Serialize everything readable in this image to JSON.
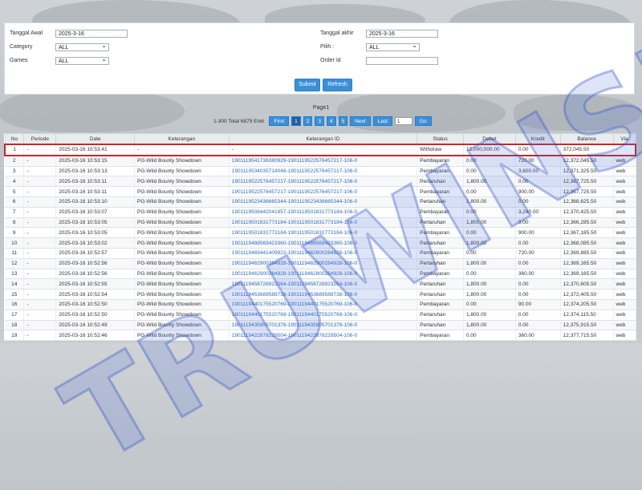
{
  "filter": {
    "tanggal_awal_label": "Tanggal Awal",
    "tanggal_awal_value": "2025-3-16",
    "tanggal_akhir_label": "Tanggal akhir",
    "tanggal_akhir_value": "2025-3-16",
    "category_label": "Category",
    "category_value": "ALL",
    "pilih_label": "Pilih :",
    "pilih_value": "ALL",
    "games_label": "Games",
    "games_value": "ALL",
    "order_label": "Order Id",
    "order_value": "",
    "submit_label": "Submit",
    "refresh_label": "Refresh"
  },
  "pager": {
    "page_title": "Page1",
    "total_text": "1-300 Total 6879 Entri",
    "first": "First",
    "pages": [
      "1",
      "2",
      "3",
      "4",
      "5"
    ],
    "next": "Next",
    "last": "Last",
    "input_value": "1",
    "go": "Go"
  },
  "watermark": "TRUWINSLOT",
  "table": {
    "headers": [
      "No",
      "Periode",
      "Date",
      "Keterangan",
      "Keterangan ID",
      "Status",
      "Debet",
      "Kredit",
      "Balance",
      "Via"
    ],
    "rows": [
      [
        "1",
        "-",
        "2025-03-16 10:53:41",
        "-",
        "-",
        "Withdraw",
        "12,000,000.00",
        "0.00",
        "372,045.50",
        "-"
      ],
      [
        "2",
        "-",
        "2025-03-16 10:53:15",
        "PG-Wild Bounty Showdown",
        "1901119541736380929-1901119522576457217-106-0",
        "Pembayaran",
        "0.00",
        "720.00",
        "12,372,045.50",
        "web"
      ],
      [
        "3",
        "-",
        "2025-03-16 10:53:13",
        "PG-Wild Bounty Showdown",
        "1901119534035714048-1901119522576457217-106-0",
        "Pembayaran",
        "0.00",
        "3,600.00",
        "12,371,325.50",
        "web"
      ],
      [
        "4",
        "-",
        "2025-03-16 10:53:11",
        "PG-Wild Bounty Showdown",
        "1901119522576457217-1901119522576457217-106-0",
        "Pertaruhan",
        "1,800.00",
        "0.00",
        "12,367,725.50",
        "web"
      ],
      [
        "5",
        "-",
        "2025-03-16 10:53:11",
        "PG-Wild Bounty Showdown",
        "1901119522576457217-1901119522576457217-106-0",
        "Pembayaran",
        "0.00",
        "900.00",
        "12,367,725.50",
        "web"
      ],
      [
        "6",
        "-",
        "2025-03-16 10:53:10",
        "PG-Wild Bounty Showdown",
        "1901119523436665344-1901119523436665344-106-0",
        "Pertaruhan",
        "1,800.00",
        "0.00",
        "12,368,625.50",
        "web"
      ],
      [
        "7",
        "-",
        "2025-03-16 10:53:07",
        "PG-Wild Bounty Showdown",
        "1901119508442041857-1901119501831773184-106-0",
        "Pembayaran",
        "0.00",
        "3,240.00",
        "12,370,425.50",
        "web"
      ],
      [
        "8",
        "-",
        "2025-03-16 10:53:05",
        "PG-Wild Bounty Showdown",
        "1901119501831773184-1901119501831773184-106-0",
        "Pertaruhan",
        "1,800.00",
        "0.00",
        "12,366,285.50",
        "web"
      ],
      [
        "9",
        "-",
        "2025-03-16 10:53:05",
        "PG-Wild Bounty Showdown",
        "1901119501831773184-1901119501831773184-106-0",
        "Pembayaran",
        "0.00",
        "900.00",
        "12,367,185.50",
        "web"
      ],
      [
        "10",
        "-",
        "2025-03-16 10:53:02",
        "PG-Wild Bounty Showdown",
        "1901119488569423360-1901119488569423360-106-0",
        "Pertaruhan",
        "1,800.00",
        "0.00",
        "12,368,085.50",
        "web"
      ],
      [
        "11",
        "-",
        "2025-03-16 10:52:57",
        "PG-Wild Bounty Showdown",
        "1901119469441409922-1901119462900284928-106-0",
        "Pembayaran",
        "0.00",
        "720.00",
        "12,369,885.50",
        "web"
      ],
      [
        "12",
        "-",
        "2025-03-16 10:52:56",
        "PG-Wild Bounty Showdown",
        "1901119462900284928-1901119462900284928-106-0",
        "Pertaruhan",
        "1,800.00",
        "0.00",
        "12,369,165.50",
        "web"
      ],
      [
        "13",
        "-",
        "2025-03-16 10:52:56",
        "PG-Wild Bounty Showdown",
        "1901119462900284928-1901119462900284928-106-0",
        "Pembayaran",
        "0.00",
        "360.00",
        "12,369,165.50",
        "web"
      ],
      [
        "14",
        "-",
        "2025-03-16 10:52:55",
        "PG-Wild Bounty Showdown",
        "1901119458726923264-1901119458726923264-106-0",
        "Pertaruhan",
        "1,800.00",
        "0.00",
        "12,370,605.50",
        "web"
      ],
      [
        "15",
        "-",
        "2025-03-16 10:52:54",
        "PG-Wild Bounty Showdown",
        "1901119453689588738-1901119453689588738-106-0",
        "Pertaruhan",
        "1,800.00",
        "0.00",
        "12,372,405.50",
        "web"
      ],
      [
        "16",
        "-",
        "2025-03-16 10:52:50",
        "PG-Wild Bounty Showdown",
        "1901119440175520769-1901119440175520769-106-0",
        "Pembayaran",
        "0.00",
        "90.00",
        "12,374,205.50",
        "web"
      ],
      [
        "17",
        "-",
        "2025-03-16 10:52:50",
        "PG-Wild Bounty Showdown",
        "1901119440175520769-1901119440175520769-106-0",
        "Pertaruhan",
        "1,800.00",
        "0.00",
        "12,374,115.50",
        "web"
      ],
      [
        "18",
        "-",
        "2025-03-16 10:52:49",
        "PG-Wild Bounty Showdown",
        "1901119435905701378-1901119435905701378-106-0",
        "Pertaruhan",
        "1,800.00",
        "0.00",
        "12,375,915.50",
        "web"
      ],
      [
        "19",
        "-",
        "2025-03-16 10:52:46",
        "PG-Wild Bounty Showdown",
        "1901119422878229504-1901119422878229504-106-0",
        "Pembayaran",
        "0.00",
        "360.00",
        "12,377,715.50",
        "web"
      ]
    ]
  }
}
